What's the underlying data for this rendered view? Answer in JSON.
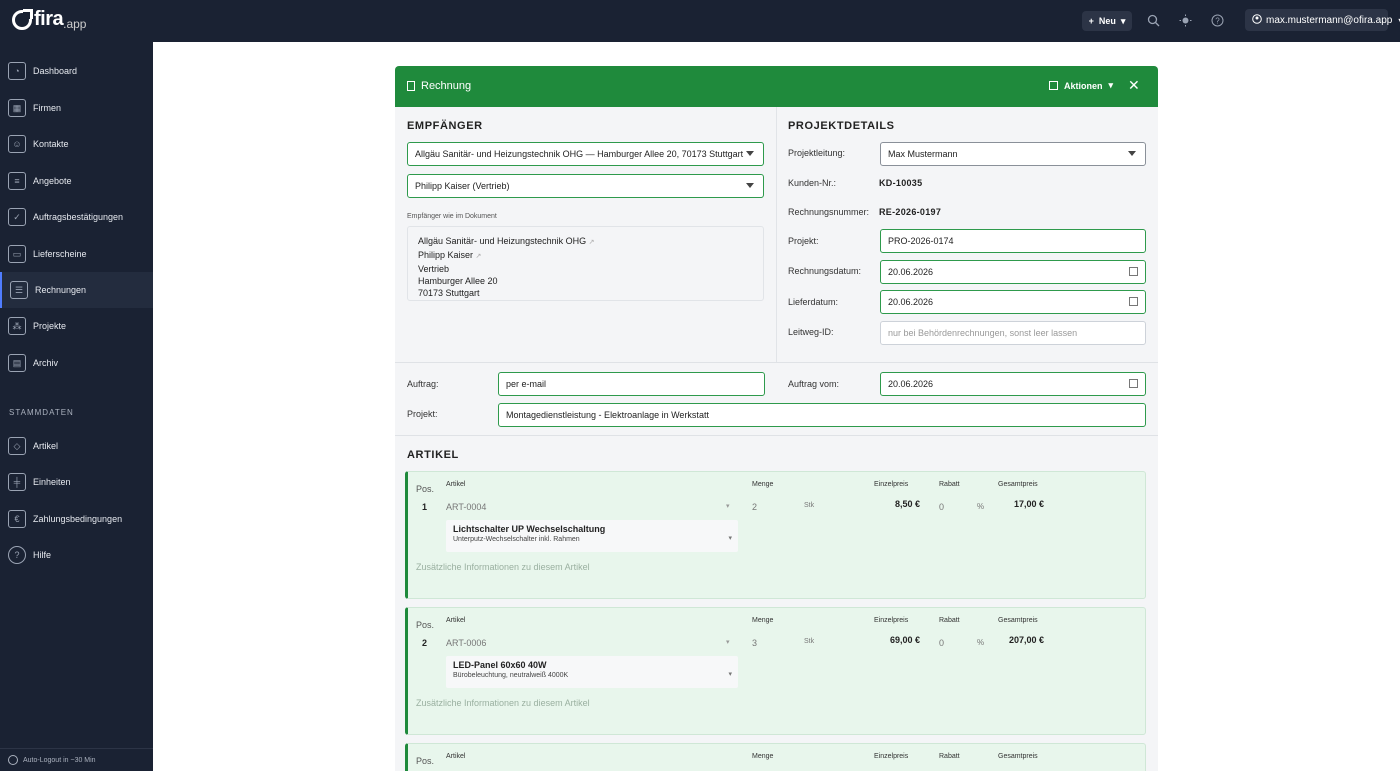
{
  "brand": {
    "name": "fira",
    "tld": ".app"
  },
  "topbar": {
    "new_label": "Neu",
    "search_icon": "search-icon",
    "theme_icon": "sun-icon",
    "help_icon": "help-icon",
    "user_email": "max.mustermann@ofira.app"
  },
  "sidebar": {
    "items": [
      {
        "label": "Dashboard",
        "icon": "dashboard-icon"
      },
      {
        "label": "Firmen",
        "icon": "building-icon"
      },
      {
        "label": "Kontakte",
        "icon": "contacts-icon"
      },
      {
        "label": "Angebote",
        "icon": "document-icon"
      },
      {
        "label": "Auftragsbestätigungen",
        "icon": "document-check-icon"
      },
      {
        "label": "Lieferscheine",
        "icon": "truck-icon"
      },
      {
        "label": "Rechnungen",
        "icon": "invoice-icon",
        "active": true
      },
      {
        "label": "Projekte",
        "icon": "projects-icon"
      },
      {
        "label": "Archiv",
        "icon": "archive-icon"
      }
    ],
    "section_label": "STAMMDATEN",
    "master_items": [
      {
        "label": "Artikel",
        "icon": "box-icon"
      },
      {
        "label": "Einheiten",
        "icon": "ruler-icon"
      },
      {
        "label": "Zahlungsbedingungen",
        "icon": "payment-icon"
      },
      {
        "label": "Hilfe",
        "icon": "help-icon"
      }
    ],
    "footer": "Auto-Logout in ~30 Min"
  },
  "card": {
    "title": "Rechnung",
    "actions_label": "Aktionen",
    "close_icon": "close-icon",
    "header_color": "#1f8a3c"
  },
  "recipient": {
    "section_title": "EMPFÄNGER",
    "company_select": "Allgäu Sanitär- und Heizungstechnik OHG — Hamburger Allee 20, 70173 Stuttgart",
    "contact_select": "Philipp Kaiser (Vertrieb)",
    "address_label": "Empfänger wie im Dokument",
    "address_lines": {
      "company": "Allgäu Sanitär- und Heizungstechnik OHG",
      "person": "Philipp Kaiser",
      "department": "Vertrieb",
      "street": "Hamburger Allee 20",
      "city": "70173 Stuttgart"
    }
  },
  "project": {
    "section_title": "PROJEKTDETAILS",
    "lead_label": "Projektleitung:",
    "lead_value": "Max Mustermann",
    "customer_no_label": "Kunden-Nr.:",
    "customer_no_value": "KD-10035",
    "invoice_no_label": "Rechnungsnummer:",
    "invoice_no_value": "RE-2026-0197",
    "project_label": "Projekt:",
    "project_value": "PRO-2026-0174",
    "invoice_date_label": "Rechnungsdatum:",
    "invoice_date_value": "20.06.2026",
    "delivery_date_label": "Lieferdatum:",
    "delivery_date_value": "20.06.2026",
    "route_id_label": "Leitweg-ID:",
    "route_id_placeholder": "nur bei Behördenrechnungen, sonst leer lassen"
  },
  "order": {
    "order_label": "Auftrag:",
    "order_value": "per e-mail",
    "order_date_label": "Auftrag vom:",
    "order_date_value": "20.06.2026",
    "project_label": "Projekt:",
    "project_value": "Montagedienstleistung - Elektroanlage in Werkstatt"
  },
  "articles": {
    "section_title": "ARTIKEL",
    "col_pos": "Pos.",
    "col_article": "Artikel",
    "col_qty": "Menge",
    "col_unit_price": "Einzelpreis",
    "col_discount": "Rabatt",
    "col_total": "Gesamtpreis",
    "extra_placeholder": "Zusätzliche Informationen zu diesem Artikel",
    "items": [
      {
        "pos": "1",
        "article": "ART-0004",
        "qty": "2",
        "unit": "Stk",
        "unit_price": "8,50 €",
        "discount": "0",
        "discount_unit": "%",
        "total": "17,00 €",
        "name": "Lichtschalter UP Wechselschaltung",
        "description": "Unterputz-Wechselschalter inkl. Rahmen"
      },
      {
        "pos": "2",
        "article": "ART-0006",
        "qty": "3",
        "unit": "Stk",
        "unit_price": "69,00 €",
        "discount": "0",
        "discount_unit": "%",
        "total": "207,00 €",
        "name": "LED-Panel 60x60 40W",
        "description": "Bürobeleuchtung, neutralweiß 4000K"
      }
    ]
  }
}
